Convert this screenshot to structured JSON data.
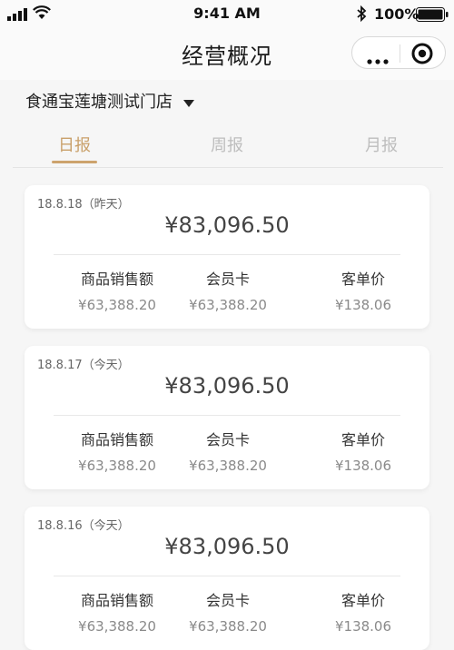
{
  "status": {
    "time": "9:41 AM",
    "battery": "100%"
  },
  "nav": {
    "title": "经营概况"
  },
  "store": {
    "name": "食通宝莲塘测试门店"
  },
  "tabs": [
    {
      "label": "日报",
      "active": true
    },
    {
      "label": "周报",
      "active": false
    },
    {
      "label": "月报",
      "active": false
    }
  ],
  "colors": {
    "accent": "#cda36d",
    "background": "#f6f6f6"
  },
  "cards": [
    {
      "date": "18.8.18（昨天）",
      "total": "¥83,096.50",
      "metrics": [
        {
          "label": "商品销售额",
          "value": "¥63,388.20"
        },
        {
          "label": "会员卡",
          "value": "¥63,388.20"
        },
        {
          "label": "客单价",
          "value": "¥138.06"
        }
      ]
    },
    {
      "date": "18.8.17（今天）",
      "total": "¥83,096.50",
      "metrics": [
        {
          "label": "商品销售额",
          "value": "¥63,388.20"
        },
        {
          "label": "会员卡",
          "value": "¥63,388.20"
        },
        {
          "label": "客单价",
          "value": "¥138.06"
        }
      ]
    },
    {
      "date": "18.8.16（今天）",
      "total": "¥83,096.50",
      "metrics": [
        {
          "label": "商品销售额",
          "value": "¥63,388.20"
        },
        {
          "label": "会员卡",
          "value": "¥63,388.20"
        },
        {
          "label": "客单价",
          "value": "¥138.06"
        }
      ]
    }
  ]
}
